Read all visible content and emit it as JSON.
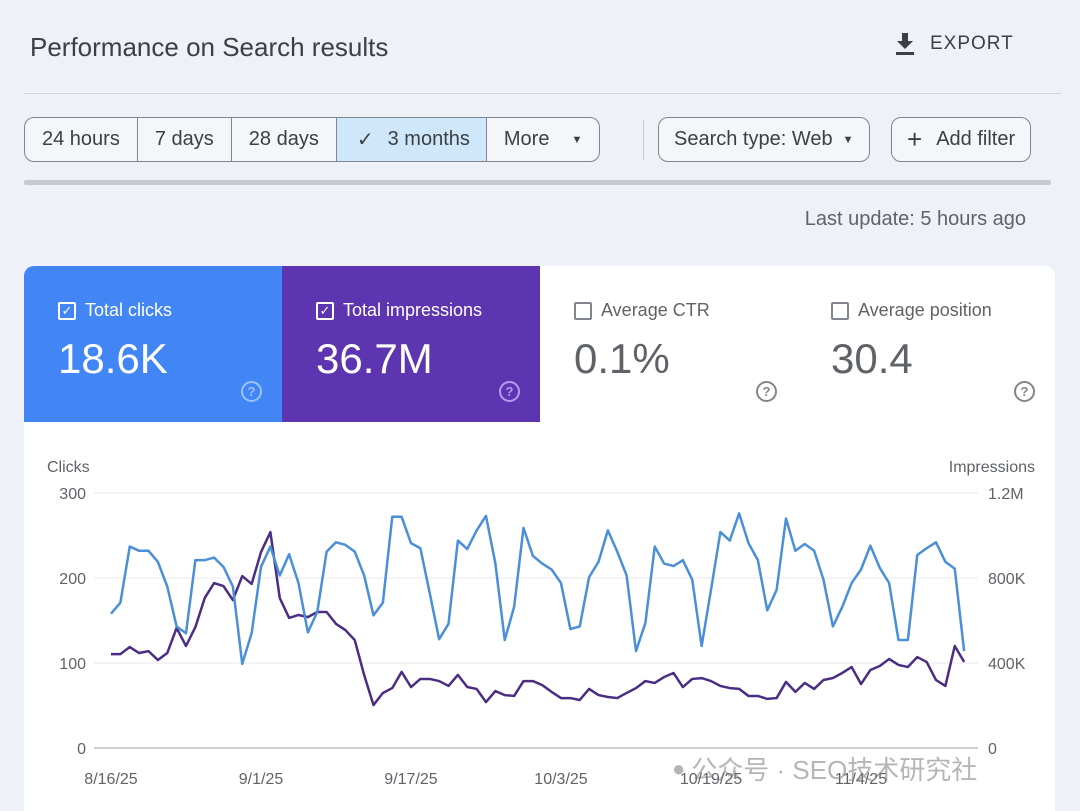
{
  "header": {
    "title": "Performance on Search results",
    "export_label": "EXPORT",
    "export_icon": "download-icon"
  },
  "filters": {
    "ranges": [
      "24 hours",
      "7 days",
      "28 days",
      "3 months",
      "More"
    ],
    "selected_range": "3 months",
    "search_type": "Search type: Web",
    "add_filter": "Add filter"
  },
  "last_update": "Last update: 5 hours ago",
  "metrics": [
    {
      "label": "Total clicks",
      "value": "18.6K",
      "checked": true,
      "color": "#4285f4"
    },
    {
      "label": "Total impressions",
      "value": "36.7M",
      "checked": true,
      "color": "#5e35b1"
    },
    {
      "label": "Average CTR",
      "value": "0.1%",
      "checked": false
    },
    {
      "label": "Average position",
      "value": "30.4",
      "checked": false
    }
  ],
  "watermark": "公众号 · SEO技术研究社",
  "chart_data": {
    "type": "line",
    "grid": true,
    "y_left": {
      "label": "Clicks",
      "ticks": [
        "300",
        "200",
        "100",
        "0"
      ],
      "range": [
        0,
        300
      ]
    },
    "y_right": {
      "label": "Impressions",
      "ticks": [
        "1.2M",
        "800K",
        "400K",
        "0"
      ],
      "range": [
        0,
        1200000
      ]
    },
    "x_ticks": [
      "8/16/25",
      "9/1/25",
      "9/17/25",
      "10/3/25",
      "10/19/25",
      "11/4/25"
    ],
    "x": [
      "8/16/25",
      "8/17/25",
      "8/18/25",
      "8/19/25",
      "8/20/25",
      "8/21/25",
      "8/22/25",
      "8/23/25",
      "8/24/25",
      "8/25/25",
      "8/26/25",
      "8/27/25",
      "8/28/25",
      "8/29/25",
      "8/30/25",
      "8/31/25",
      "9/1/25",
      "9/2/25",
      "9/3/25",
      "9/4/25",
      "9/5/25",
      "9/6/25",
      "9/7/25",
      "9/8/25",
      "9/9/25",
      "9/10/25",
      "9/11/25",
      "9/12/25",
      "9/13/25",
      "9/14/25",
      "9/15/25",
      "9/16/25",
      "9/17/25",
      "9/18/25",
      "9/19/25",
      "9/20/25",
      "9/21/25",
      "9/22/25",
      "9/23/25",
      "9/24/25",
      "9/25/25",
      "9/26/25",
      "9/27/25",
      "9/28/25",
      "9/29/25",
      "9/30/25",
      "10/1/25",
      "10/2/25",
      "10/3/25",
      "10/4/25",
      "10/5/25",
      "10/6/25",
      "10/7/25",
      "10/8/25",
      "10/9/25",
      "10/10/25",
      "10/11/25",
      "10/12/25",
      "10/13/25",
      "10/14/25",
      "10/15/25",
      "10/16/25",
      "10/17/25",
      "10/18/25",
      "10/19/25",
      "10/20/25",
      "10/21/25",
      "10/22/25",
      "10/23/25",
      "10/24/25",
      "10/25/25",
      "10/26/25",
      "10/27/25",
      "10/28/25",
      "10/29/25",
      "10/30/25",
      "10/31/25",
      "11/1/25",
      "11/2/25",
      "11/3/25",
      "11/4/25",
      "11/5/25",
      "11/6/25",
      "11/7/25",
      "11/8/25",
      "11/9/25",
      "11/10/25",
      "11/11/25",
      "11/12/25",
      "11/13/25",
      "11/14/25",
      "11/15/25"
    ],
    "series": [
      {
        "name": "Clicks",
        "axis": "left",
        "color": "#4a8fd8",
        "values": [
          158,
          171,
          237,
          232,
          232,
          219,
          190,
          143,
          135,
          221,
          221,
          224,
          213,
          190,
          99,
          135,
          213,
          237,
          203,
          228,
          194,
          136,
          160,
          231,
          242,
          239,
          231,
          203,
          156,
          171,
          272,
          272,
          241,
          235,
          182,
          128,
          146,
          244,
          234,
          256,
          273,
          217,
          127,
          166,
          259,
          226,
          217,
          210,
          194,
          140,
          143,
          201,
          219,
          256,
          231,
          203,
          114,
          147,
          237,
          217,
          214,
          221,
          198,
          120,
          186,
          254,
          244,
          276,
          241,
          221,
          162,
          186,
          270,
          232,
          240,
          232,
          198,
          143,
          166,
          194,
          210,
          238,
          212,
          194,
          127,
          127,
          227,
          235,
          242,
          219,
          211,
          114
        ]
      },
      {
        "name": "Impressions",
        "axis": "right",
        "color": "#4b2d83",
        "values": [
          442000,
          442000,
          475000,
          447000,
          456000,
          414000,
          447000,
          565000,
          480000,
          569000,
          706000,
          776000,
          762000,
          696000,
          809000,
          772000,
          922000,
          1016000,
          706000,
          612000,
          626000,
          616000,
          640000,
          640000,
          584000,
          555000,
          508000,
          344000,
          202000,
          259000,
          282000,
          358000,
          287000,
          325000,
          325000,
          315000,
          292000,
          344000,
          287000,
          278000,
          216000,
          268000,
          249000,
          245000,
          315000,
          315000,
          296000,
          264000,
          235000,
          235000,
          226000,
          278000,
          249000,
          240000,
          235000,
          259000,
          282000,
          315000,
          306000,
          334000,
          353000,
          287000,
          325000,
          329000,
          315000,
          292000,
          282000,
          278000,
          245000,
          245000,
          231000,
          235000,
          311000,
          264000,
          306000,
          278000,
          320000,
          329000,
          353000,
          381000,
          301000,
          367000,
          386000,
          419000,
          391000,
          381000,
          428000,
          405000,
          320000,
          292000,
          480000,
          405000
        ]
      }
    ]
  }
}
